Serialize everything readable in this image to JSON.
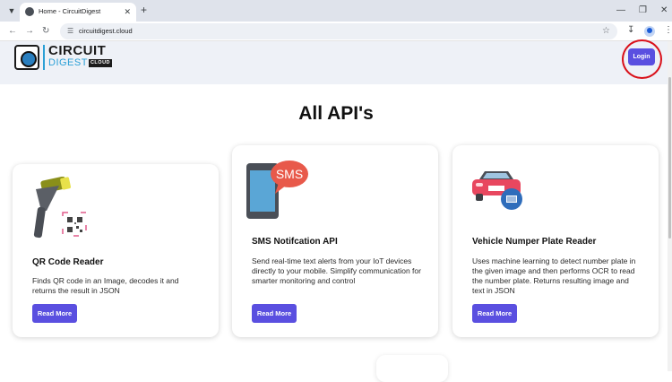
{
  "browser": {
    "tab_title": "Home - CircuitDigest",
    "new_tab_glyph": "+",
    "tab_close_glyph": "✕",
    "url": "circuitdigest.cloud",
    "icons": {
      "tab_menu": "chevron-down-icon",
      "back": "back-arrow-icon",
      "forward": "forward-arrow-icon",
      "reload": "reload-icon",
      "site_info": "site-info-icon",
      "bookmark": "star-icon",
      "downloads": "download-icon",
      "profile": "profile-icon",
      "menu": "more-vert-icon"
    }
  },
  "header": {
    "logo_line1": "CIRCUIT",
    "logo_line2": "DIGEST",
    "logo_tag": "CLOUD",
    "login_label": "Login"
  },
  "main": {
    "title": "All API's",
    "cards": [
      {
        "title": "QR Code Reader",
        "description": "Finds QR code in an Image, decodes it and returns the result in JSON",
        "button": "Read More",
        "icon": "barcode-scanner-icon"
      },
      {
        "title": "SMS Notifcation API",
        "description": "Send real-time text alerts from your IoT devices directly to your mobile. Simplify communication for smarter monitoring and control",
        "button": "Read More",
        "icon": "sms-phone-icon",
        "icon_text": "SMS"
      },
      {
        "title": "Vehicle Numper Plate Reader",
        "description": "Uses machine learning to detect number plate in the given image and then performs OCR to read the number plate. Returns resulting image and text in JSON",
        "button": "Read More",
        "icon": "car-plate-icon"
      }
    ]
  },
  "colors": {
    "accent": "#5a4fe0",
    "header_bg": "#eef1f7",
    "highlight_ring": "#d9111a",
    "logo_blue": "#2a9fd6"
  }
}
